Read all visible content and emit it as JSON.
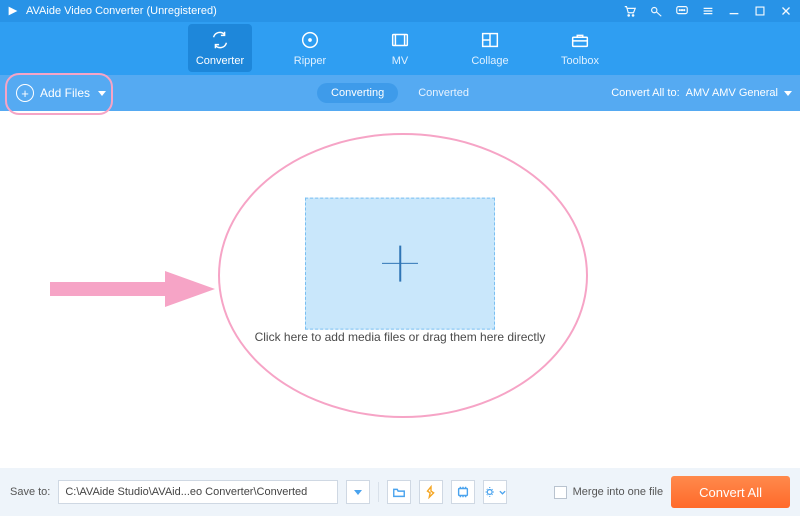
{
  "title": "AVAide Video Converter (Unregistered)",
  "titlebar_icons": [
    "cart",
    "key",
    "comment",
    "menu",
    "minimize",
    "maximize",
    "close"
  ],
  "tabs": [
    {
      "label": "Converter",
      "icon": "convert",
      "active": true
    },
    {
      "label": "Ripper",
      "icon": "ripper",
      "active": false
    },
    {
      "label": "MV",
      "icon": "mv",
      "active": false
    },
    {
      "label": "Collage",
      "icon": "collage",
      "active": false
    },
    {
      "label": "Toolbox",
      "icon": "toolbox",
      "active": false
    }
  ],
  "add_files_label": "Add Files",
  "segments": [
    {
      "label": "Converting",
      "active": true
    },
    {
      "label": "Converted",
      "active": false
    }
  ],
  "convert_all_to": {
    "label": "Convert All to:",
    "value": "AMV AMV General"
  },
  "drop_caption": "Click here to add media files or drag them here directly",
  "bottom": {
    "save_label": "Save to:",
    "save_path": "C:\\AVAide Studio\\AVAid...eo Converter\\Converted",
    "merge_label": "Merge into one file",
    "convert_button": "Convert All",
    "tool_icons": [
      "open-folder",
      "hwaccel",
      "gpu",
      "settings"
    ]
  },
  "colors": {
    "primary": "#2f9ef2",
    "accent": "#ff7a3a",
    "annotation": "#f6a4c6"
  }
}
